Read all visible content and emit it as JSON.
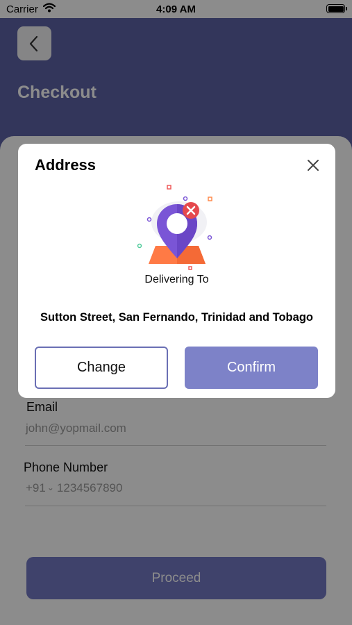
{
  "status_bar": {
    "carrier": "Carrier",
    "time": "4:09 AM"
  },
  "header": {
    "title": "Checkout",
    "back_icon": "chevron-left-icon"
  },
  "form": {
    "email": {
      "label": "Email",
      "value": "john@yopmail.com"
    },
    "phone": {
      "label": "Phone Number",
      "country_code": "+91",
      "number": "1234567890"
    },
    "proceed_label": "Proceed"
  },
  "modal": {
    "title": "Address",
    "close_icon": "close-icon",
    "illustration_icon": "location-pin-icon",
    "caption": "Delivering To",
    "address": "Sutton Street, San Fernando, Trinidad and Tobago",
    "change_label": "Change",
    "confirm_label": "Confirm"
  },
  "colors": {
    "primary": "#5d63a6",
    "button": "#7d82c8",
    "pin": "#7a55d6",
    "map": "#ff7a45",
    "error": "#e5484d"
  }
}
